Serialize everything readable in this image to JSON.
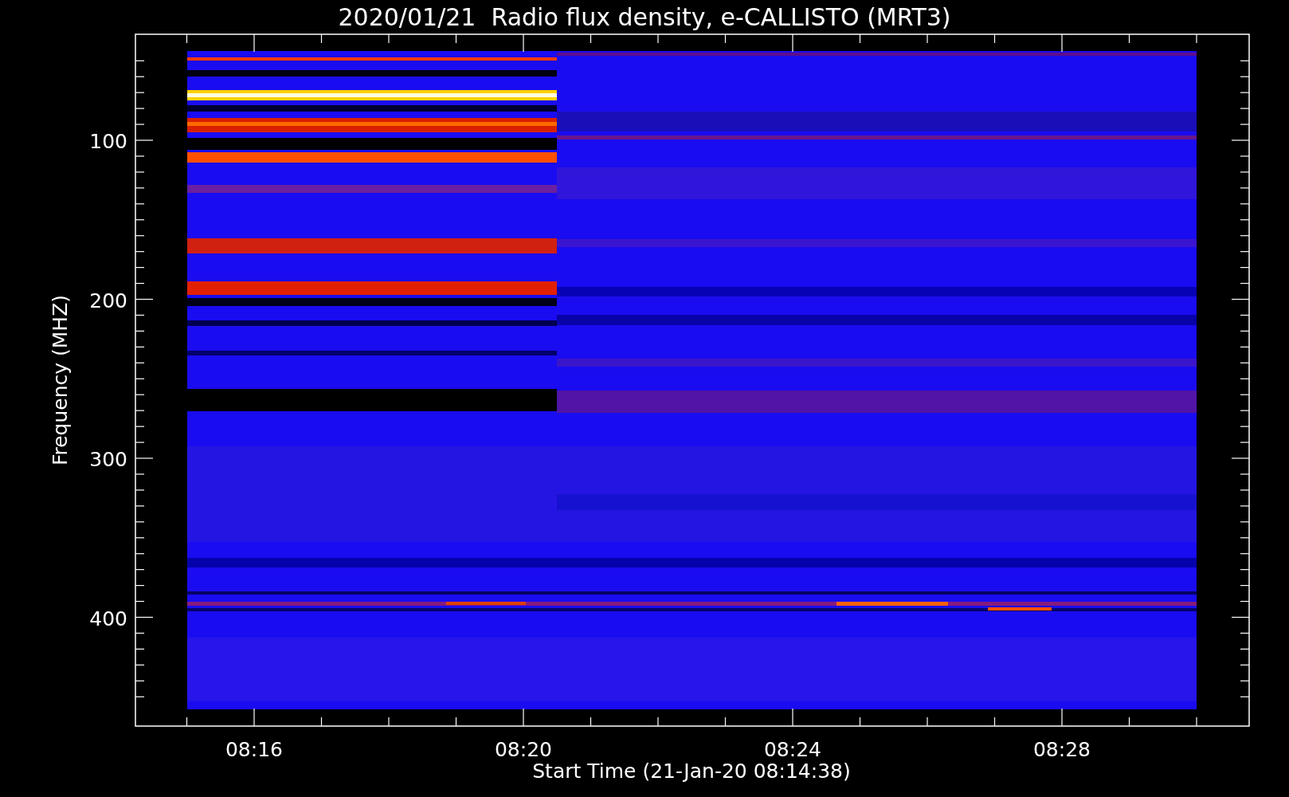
{
  "title": "2020/01/21  Radio flux density, e-CALLISTO (MRT3)",
  "y_axis": {
    "label": "Frequency (MHZ)",
    "ticks": [
      "100",
      "200",
      "300",
      "400"
    ]
  },
  "x_axis": {
    "label": "Start Time (21-Jan-20 08:14:38)",
    "ticks": [
      "08:16",
      "08:20",
      "08:24",
      "08:28"
    ]
  }
}
